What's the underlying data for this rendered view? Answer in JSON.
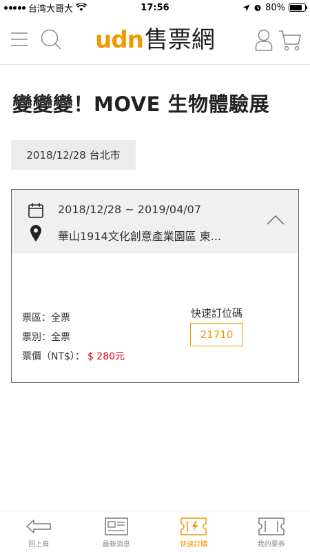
{
  "status_bar": {
    "carrier": "台湾大哥大",
    "time": "17:56",
    "battery": "80%",
    "battery_level": 0.8
  },
  "header": {
    "logo_latin": "udn",
    "logo_cjk": "售票網",
    "icons": {
      "menu": "menu-icon",
      "search": "search-icon",
      "user": "user-icon",
      "cart": "cart-icon"
    }
  },
  "event": {
    "title": "變變變！MOVE 生物體驗展",
    "session_chip": "2018/12/28 台北市"
  },
  "card": {
    "date_range": "2018/12/28 ~ 2019/04/07",
    "venue": "華山1914文化創意產業園區 東...",
    "zone": "票區：全票",
    "ticket_type": "票別：全票",
    "price_label": "票價（NT$）：",
    "price_value": "$ 280元",
    "quick_code_label": "快速訂位碼",
    "quick_code": "21710"
  },
  "colors": {
    "accent": "#f39800",
    "price_red": "#e60012"
  },
  "tabbar": {
    "items": [
      {
        "label": "回上頁",
        "icon": "back-arrow-icon"
      },
      {
        "label": "最新消息",
        "icon": "news-icon"
      },
      {
        "label": "快速訂購",
        "icon": "quick-ticket-icon",
        "active": true
      },
      {
        "label": "我的票券",
        "icon": "ticket-icon"
      }
    ]
  }
}
